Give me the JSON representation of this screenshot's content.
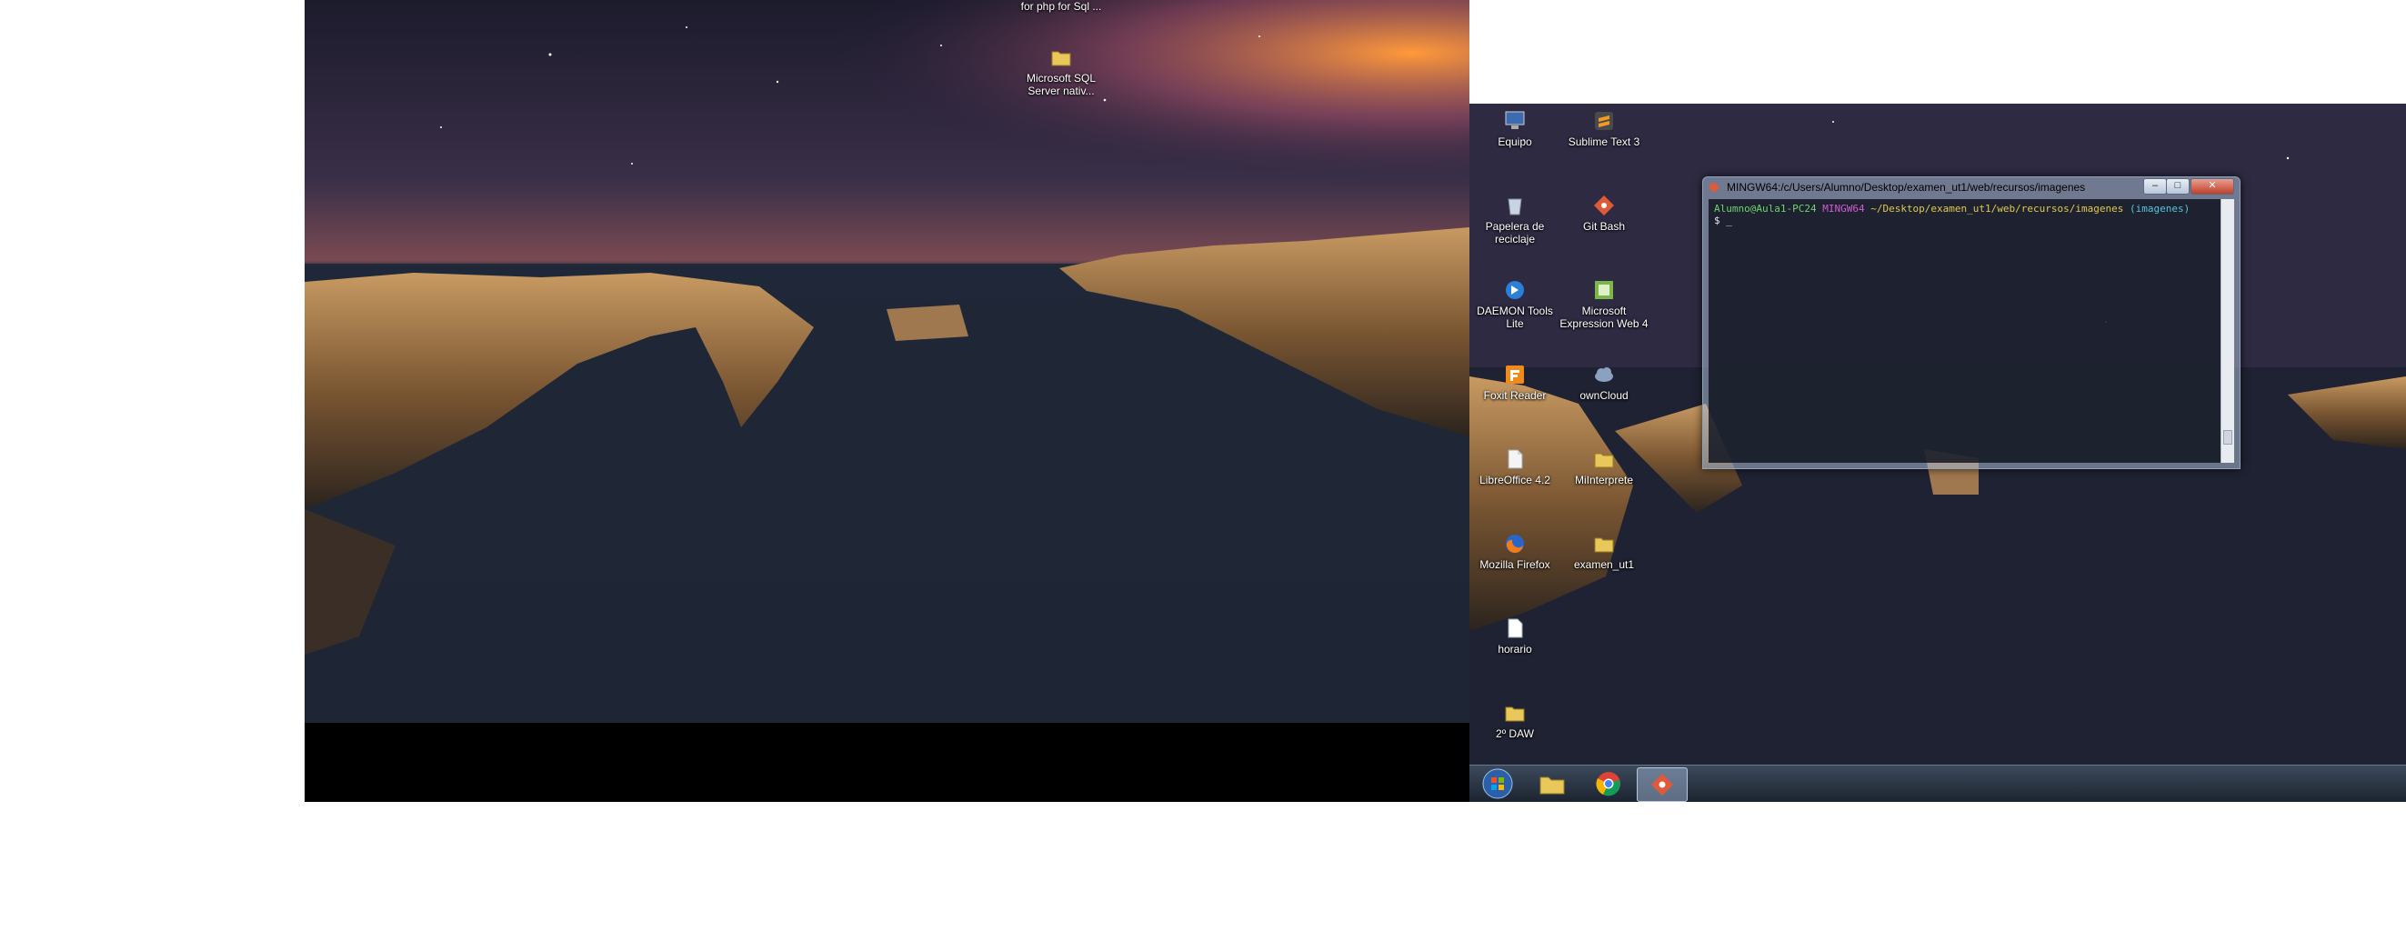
{
  "left_monitor": {
    "desktop_icons": [
      {
        "label": "for php for Sql ...",
        "icon": "folder-icon"
      },
      {
        "label": "Microsoft SQL Server nativ...",
        "icon": "folder-icon"
      }
    ]
  },
  "right_monitor": {
    "desktop_icons": [
      {
        "label": "Equipo",
        "icon": "computer-icon"
      },
      {
        "label": "Sublime Text 3",
        "icon": "sublime-text-icon"
      },
      {
        "label": "Papelera de reciclaje",
        "icon": "recycle-bin-icon"
      },
      {
        "label": "Git Bash",
        "icon": "git-bash-icon"
      },
      {
        "label": "DAEMON Tools Lite",
        "icon": "daemon-tools-icon"
      },
      {
        "label": "Microsoft Expression Web 4",
        "icon": "expression-web-icon"
      },
      {
        "label": "Foxit Reader",
        "icon": "foxit-reader-icon"
      },
      {
        "label": "ownCloud",
        "icon": "owncloud-icon"
      },
      {
        "label": "LibreOffice 4.2",
        "icon": "libreoffice-icon"
      },
      {
        "label": "MiInterprete",
        "icon": "folder-icon"
      },
      {
        "label": "Mozilla Firefox",
        "icon": "firefox-icon"
      },
      {
        "label": "examen_ut1",
        "icon": "folder-icon"
      },
      {
        "label": "horario",
        "icon": "document-icon"
      },
      {
        "label": "2º DAW",
        "icon": "folder-icon"
      }
    ],
    "terminal": {
      "title": "MINGW64:/c/Users/Alumno/Desktop/examen_ut1/web/recursos/imagenes",
      "prompt_user": "Alumno@Aula1-PC24",
      "prompt_system": "MINGW64",
      "prompt_path": "~/Desktop/examen_ut1/web/recursos/imagenes",
      "prompt_branch": "(imagenes)",
      "prompt_line": "$ _",
      "controls": {
        "minimize": "–",
        "maximize": "□",
        "close": "✕"
      }
    },
    "taskbar": {
      "buttons": [
        {
          "name": "start-button",
          "icon": "windows-logo-icon"
        },
        {
          "name": "explorer-button",
          "icon": "folder-icon"
        },
        {
          "name": "chrome-button",
          "icon": "chrome-icon"
        },
        {
          "name": "git-bash-taskbar-button",
          "icon": "git-bash-icon",
          "active": true
        }
      ]
    }
  },
  "colors": {
    "prompt_user": "#6cd36c",
    "prompt_system": "#d25bd2",
    "prompt_path": "#e0c94a",
    "prompt_branch": "#4fc7dc",
    "taskbar": "#1c2430"
  }
}
